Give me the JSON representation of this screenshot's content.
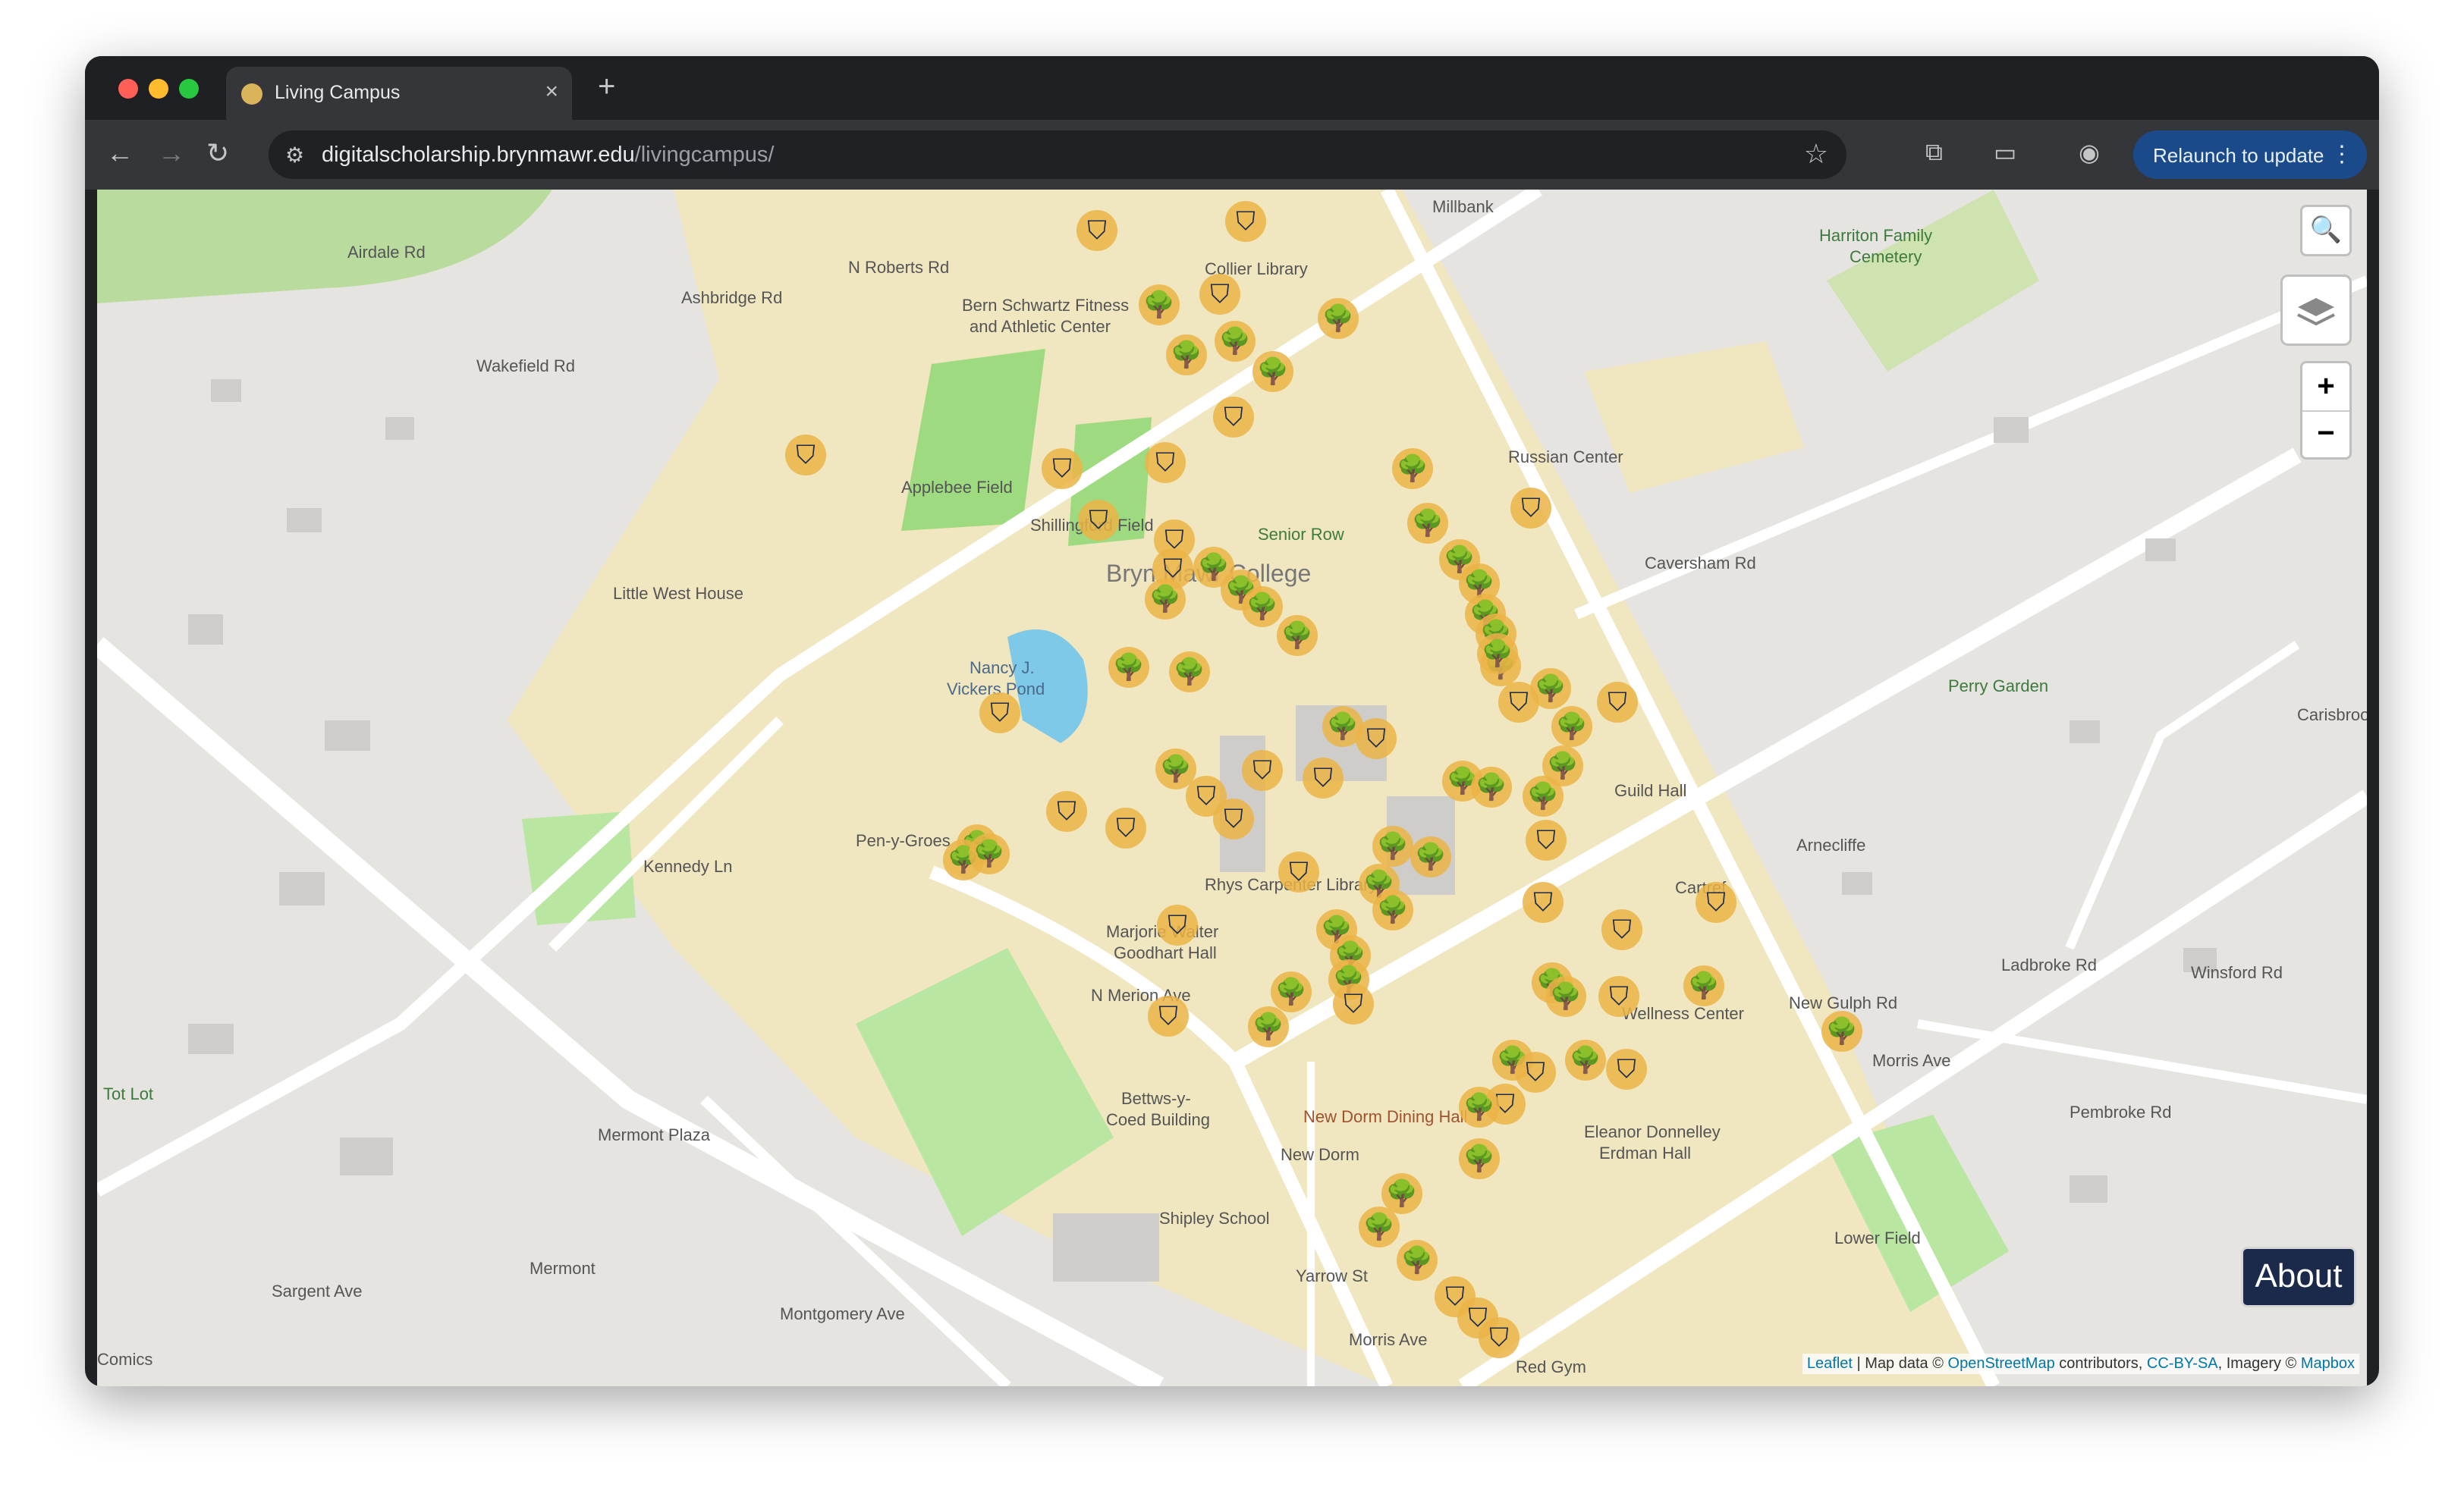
{
  "browser": {
    "tab_title": "Living Campus",
    "tab_close": "×",
    "new_tab": "+",
    "url_host": "digitalscholarship.brynmawr.edu",
    "url_path": "/livingcampus/",
    "relaunch_label": "Relaunch to update",
    "icons": {
      "back": "←",
      "forward": "→",
      "reload": "↻",
      "site_info": "⚙",
      "bookmark": "☆",
      "extensions": "⧉",
      "cast": "▭",
      "profile": "◉",
      "menu": "⋮"
    }
  },
  "map": {
    "controls": {
      "search_icon": "🔍",
      "zoom_in": "+",
      "zoom_out": "−",
      "about_label": "About"
    },
    "attribution": {
      "leaflet": "Leaflet",
      "sep1": " | Map data © ",
      "osm": "OpenStreetMap",
      "sep2": " contributors, ",
      "license": "CC-BY-SA",
      "sep3": ", Imagery © ",
      "mapbox": "Mapbox"
    },
    "labels": [
      "Airdale Rd",
      "N Roberts Rd",
      "Ashbridge Rd",
      "Wakefield Rd",
      "Bern Schwartz Fitness",
      "and Athletic Center",
      "Collier Library",
      "Millbank",
      "Harriton Family",
      "Cemetery",
      "Russian Center",
      "Applebee Field",
      "Shillingford Field",
      "Senior Row",
      "Bryn Mawr College",
      "Little West House",
      "Caversham Rd",
      "Nancy J.",
      "Vickers Pond",
      "Perry Garden",
      "Rhys Carpenter Library",
      "Pen-y-Groes",
      "Kennedy Ln",
      "Marjorie Walter",
      "Goodhart Hall",
      "N Merion Ave",
      "Cartref",
      "Arnecliffe",
      "Wellness Center",
      "New Dorm Dining Hall",
      "New Dorm",
      "Bettws-y-",
      "Coed Building",
      "Mermont Plaza",
      "Tot Lot",
      "Shipley School",
      "Eleanor Donnelley",
      "Erdman Hall",
      "Lower Field",
      "Mermont",
      "Montgomery Ave",
      "Sargent Ave",
      "Yarrow St",
      "Morris Ave",
      "Red Gym",
      "New Gulph Rd",
      "Ladbroke Rd",
      "Winsford Rd",
      "Pembroke Rd",
      "Carisbrooke",
      "Comics",
      "Guild Hall",
      "Morris Ave"
    ],
    "marker_icons": {
      "lamp": "⛉",
      "tree": "🌳"
    }
  }
}
